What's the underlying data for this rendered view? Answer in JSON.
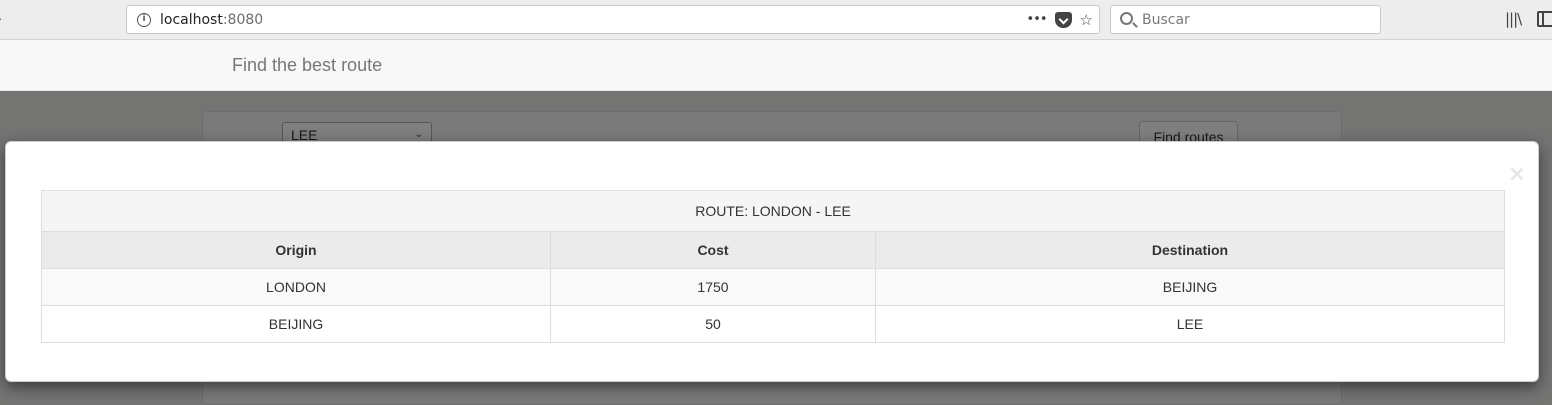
{
  "browser": {
    "url_host": "localhost",
    "url_port": ":8080",
    "search_placeholder": "Buscar"
  },
  "navbar": {
    "brand": "Find the best route"
  },
  "form": {
    "selected_destination": "LEE",
    "find_button_label": "Find routes"
  },
  "modal": {
    "close_glyph": "×",
    "route_title": "ROUTE: LONDON - LEE",
    "columns": [
      "Origin",
      "Cost",
      "Destination"
    ],
    "rows": [
      {
        "origin": "LONDON",
        "cost": "1750",
        "destination": "BEIJING"
      },
      {
        "origin": "BEIJING",
        "cost": "50",
        "destination": "LEE"
      }
    ]
  }
}
